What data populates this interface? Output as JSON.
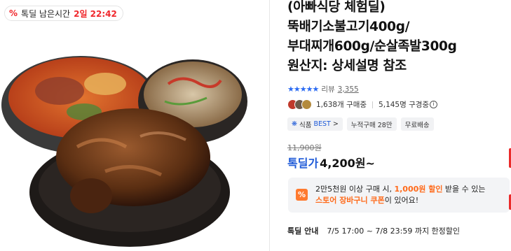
{
  "deal_badge": {
    "icon": "percent-icon",
    "label": "톡딜 남은시간",
    "time": "2일 22:42"
  },
  "product": {
    "title_lines": [
      "(아빠식당 체험딜)",
      "뚝배기소불고기400g/",
      "부대찌개600g/순살족발300g",
      "원산지: 상세설명 참조"
    ],
    "rating_stars": "★★★★★",
    "review_label": "리뷰",
    "review_count": "3,355",
    "buyers": "1,638개 구매중",
    "viewers": "5,145명 구경중",
    "tags": [
      {
        "prefix": "식품",
        "label": "BEST",
        "suffix": ">"
      },
      {
        "label": "누적구매 28만"
      },
      {
        "label": "무료배송"
      }
    ],
    "original_price": "11,900원",
    "price_label": "톡딜가",
    "price": "4,200원~"
  },
  "coupon": {
    "icon": "%",
    "line1_a": "2만5천원 이상 구매 시, ",
    "line1_b": "1,000원 할인",
    "line1_c": " 받을 수 있는",
    "line2_a": "스토어 장바구니 쿠폰",
    "line2_b": "이 있어요!"
  },
  "deal_info": {
    "label": "톡딜 안내",
    "text": "7/5 17:00 ~ 7/8 23:59 까지 한정할인"
  },
  "colors": {
    "accent_blue": "#1f5bd8",
    "deal_red": "#f0282d",
    "coupon_orange": "#ff6a1a"
  }
}
